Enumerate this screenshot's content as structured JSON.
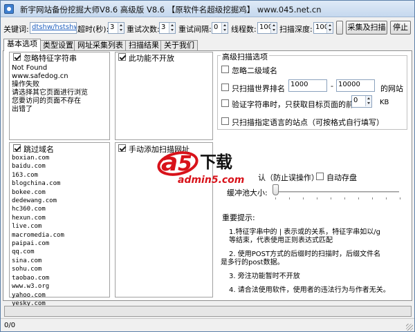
{
  "window": {
    "title": "新宇网站备份挖掘大师V8.6  高级版 V8.6  【原软件名超级挖掘鸡】 www.045.net.cn"
  },
  "toolbar": {
    "keyword_label": "关键词:",
    "keyword_value": "dtshw/hstshw",
    "timeout_label": "超时(秒):",
    "timeout_value": "3",
    "retry_label": "重试次数:",
    "retry_value": "3",
    "retry_interval_label": "重试间隔:",
    "retry_interval_value": "0",
    "threads_label": "线程数:",
    "threads_value": "100",
    "depth_label": "扫描深度:",
    "depth_value": "100",
    "collect_scan_label": "采集及扫描",
    "stop_label": "停止"
  },
  "tabs": [
    {
      "label": "基本选项",
      "active": true
    },
    {
      "label": "类型设置",
      "active": false
    },
    {
      "label": "网址采集列表",
      "active": false
    },
    {
      "label": "扫描结果",
      "active": false
    },
    {
      "label": "关于我们",
      "active": false
    }
  ],
  "panels": {
    "ignore_signature": {
      "label": "忽略特征字符串",
      "checked": true,
      "lines": [
        "Not Found",
        "www.safedog.cn",
        "操作失败",
        "请选择其它页面进行浏览",
        "您要访问的页面不存在",
        "出错了"
      ]
    },
    "disabled_feature": {
      "label": "此功能不开放",
      "checked": true
    },
    "skip_domains": {
      "label": "跳过域名",
      "checked": true,
      "lines": [
        "boxian.com",
        "baidu.com",
        "163.com",
        "blogchina.com",
        "bokee.com",
        "dedewang.com",
        "hc360.com",
        "hexun.com",
        "live.com",
        "macromedia.com",
        "paipai.com",
        "qq.com",
        "sina.com",
        "sohu.com",
        "taobao.com",
        "www.w3.org",
        "yahoo.com",
        "yesky.com"
      ]
    },
    "manual_add": {
      "label": "手动添加扫描网址",
      "checked": true
    }
  },
  "advanced": {
    "group_title": "高级扫描选项",
    "ignore_subdomain": "忽略二级域名",
    "world_rank_label": "只扫描世界排名",
    "world_rank_from": "1000",
    "world_rank_sep": "-",
    "world_rank_to": "10000",
    "world_rank_suffix": "的网站",
    "verify_label": "验证字符串时，只获取目标页面的前",
    "verify_value": "0",
    "verify_unit": "KB",
    "lang_label": "只扫描指定语言的站点（可按格式自行填写）",
    "confirm_label": "认（防止误操作）",
    "autosave_label": "自动存盘",
    "buffer_label": "缓冲池大小:",
    "buffer_level": 0
  },
  "notes": {
    "heading": "重要提示:",
    "items": [
      "1.特征字串中的 | 表示或的关系，特征字串如以/g",
      "等结束，代表使用正则表达式匹配",
      "2. 使用POST方式的后缀时的扫描时，后缀文件名",
      "是多行的post数据。",
      "3.  旁注功能暂时不开放",
      "4.  请合法使用软件，使用者的违法行为与作者无关。"
    ]
  },
  "watermark": {
    "cn_text": "下载",
    "url_text": "admin5.com"
  },
  "progress": {
    "value": 0
  },
  "status": {
    "text": "0/0"
  },
  "colors": {
    "accent": "#3e7fd0",
    "watermark_red": "#d8121a"
  }
}
